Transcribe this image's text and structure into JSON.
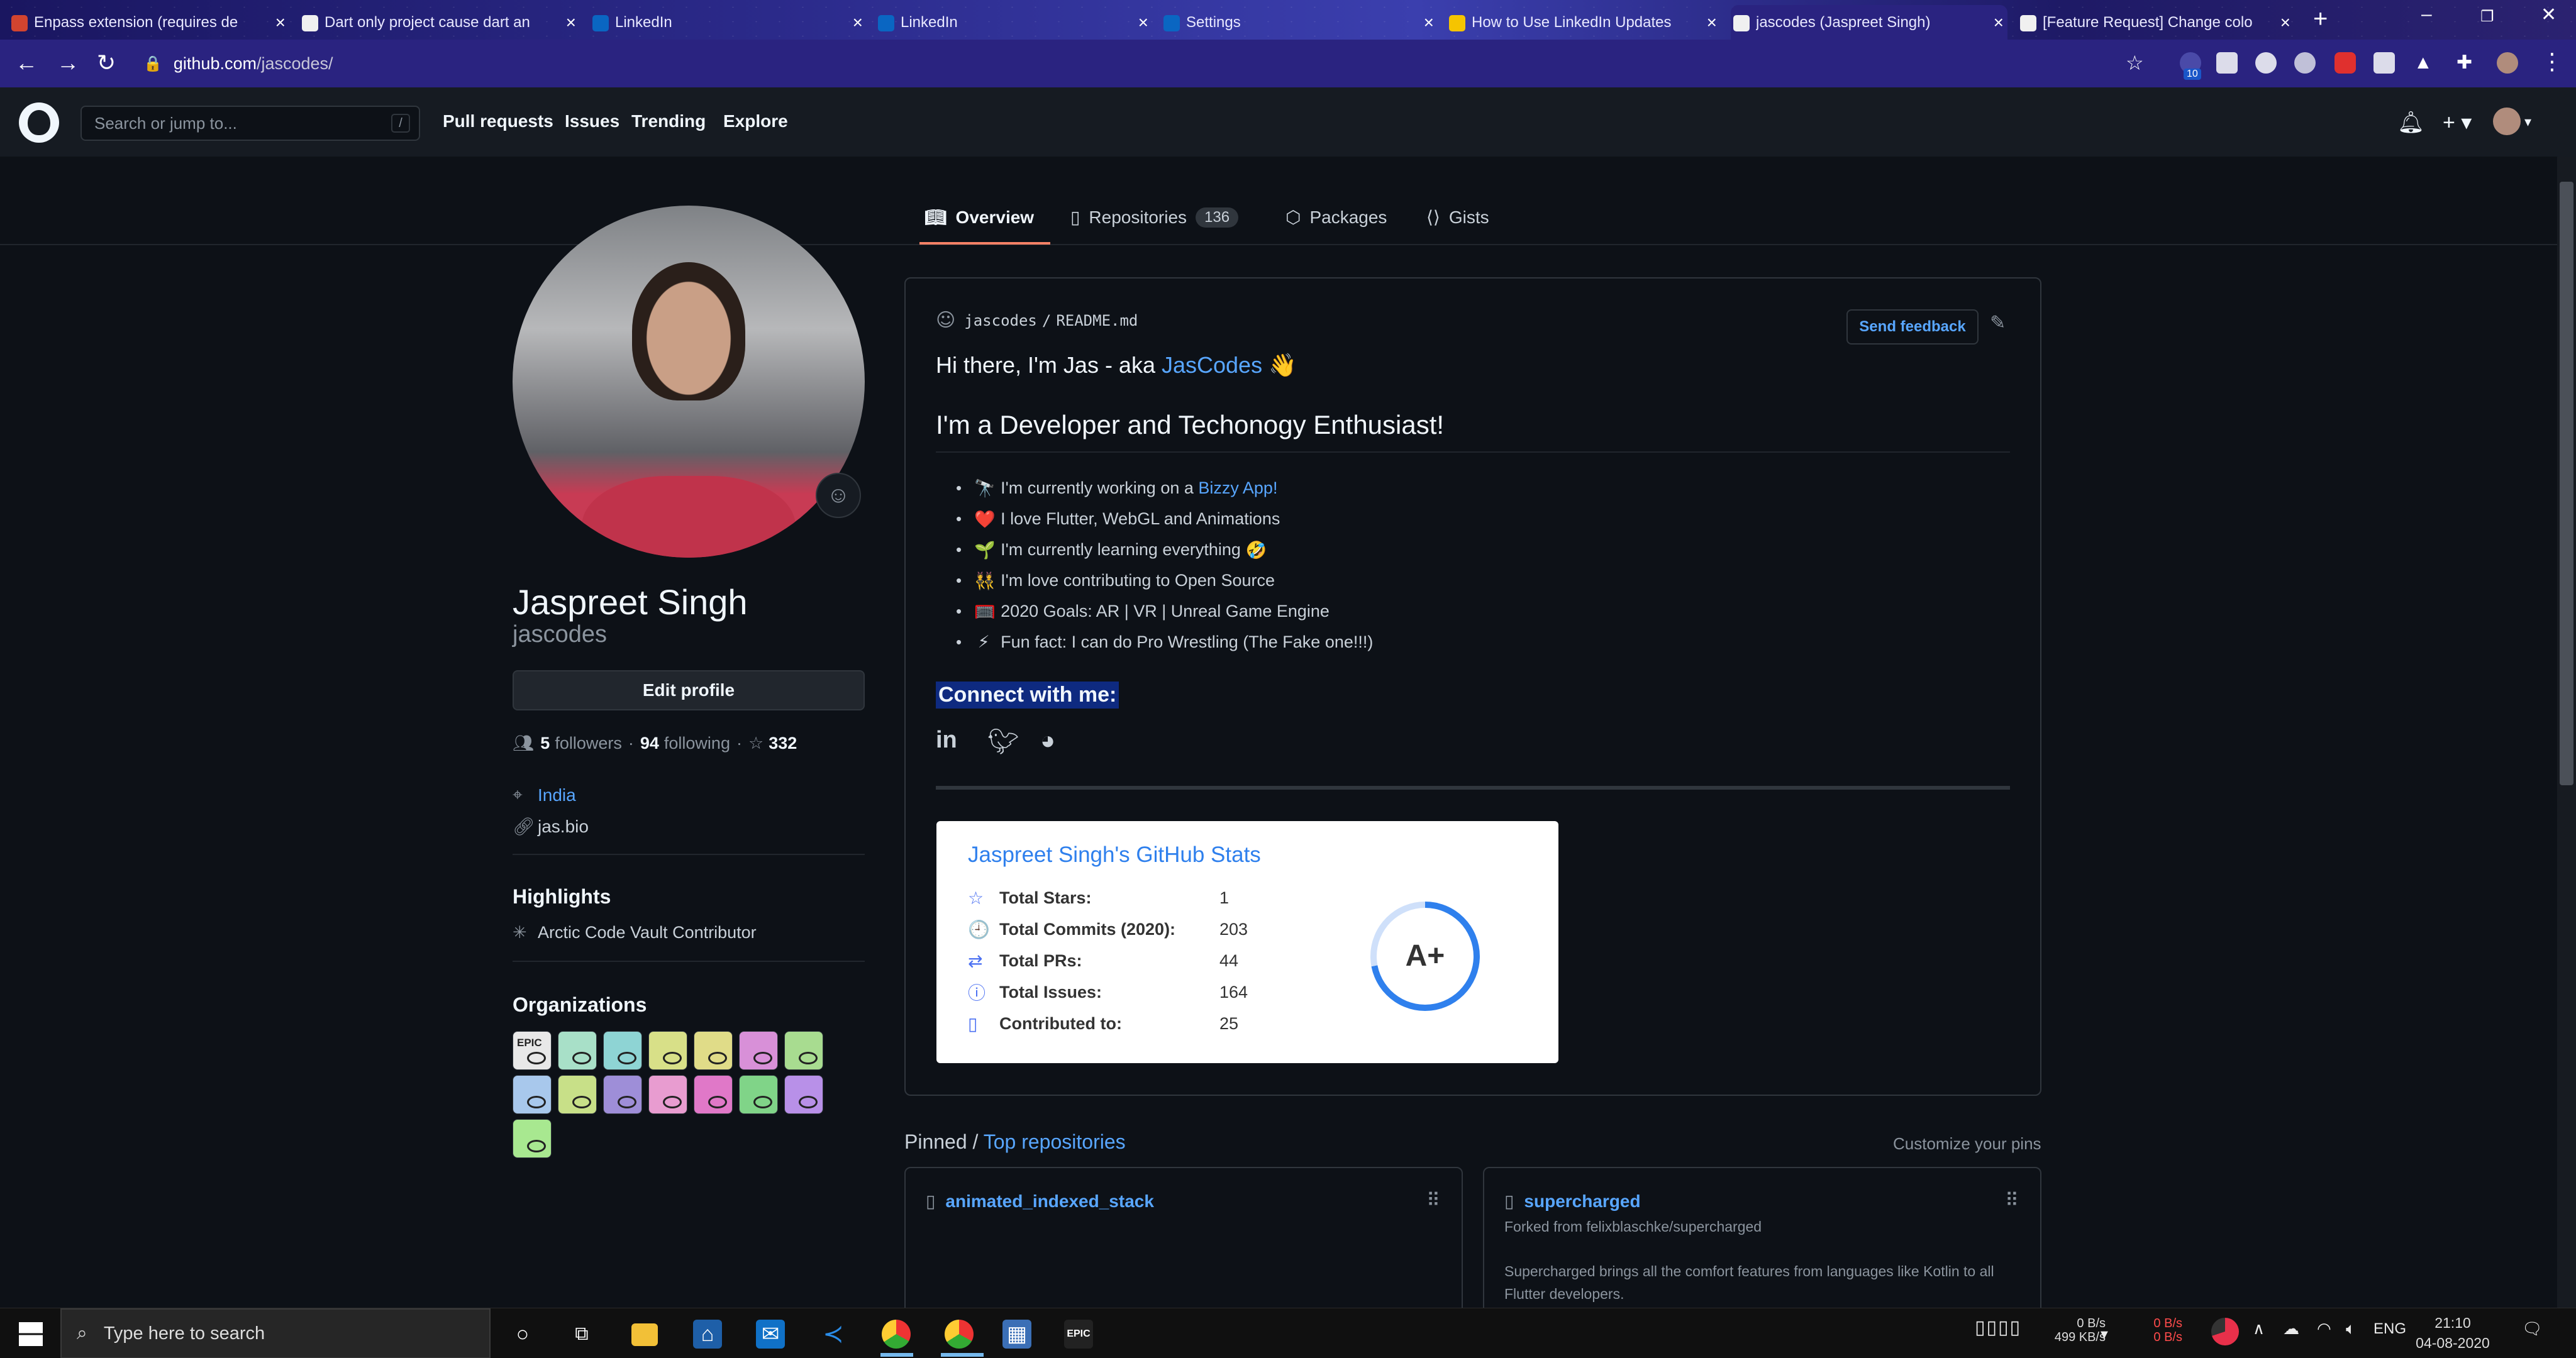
{
  "browser": {
    "tabs": [
      {
        "title": "Enpass extension (requires de",
        "favicon_color": "#d2442f"
      },
      {
        "title": "Dart only project cause dart an",
        "favicon_color": "#f0f0f0"
      },
      {
        "title": "LinkedIn",
        "favicon_color": "#0a66c2"
      },
      {
        "title": "LinkedIn",
        "favicon_color": "#0a66c2"
      },
      {
        "title": "Settings",
        "favicon_color": "#0a66c2"
      },
      {
        "title": "How to Use LinkedIn Updates",
        "favicon_color": "#f5c400"
      },
      {
        "title": "jascodes (Jaspreet Singh)",
        "favicon_color": "#f0f0f0"
      },
      {
        "title": "[Feature Request] Change colo",
        "favicon_color": "#f0f0f0"
      }
    ],
    "active_tab": 6,
    "url_host": "github.com",
    "url_path": "/jascodes/",
    "extension_badge": "10"
  },
  "github_header": {
    "search_placeholder": "Search or jump to...",
    "search_shortcut": "/",
    "nav": [
      "Pull requests",
      "Issues",
      "Trending",
      "Explore"
    ]
  },
  "profile_tabs": [
    {
      "label": "Overview",
      "icon": "book-icon",
      "glyph": "📖"
    },
    {
      "label": "Repositories",
      "icon": "repo-icon",
      "glyph": "▯",
      "count": "136"
    },
    {
      "label": "Packages",
      "icon": "package-icon",
      "glyph": "⬡"
    },
    {
      "label": "Gists",
      "icon": "code-square-icon",
      "glyph": "⟨⟩"
    }
  ],
  "profile": {
    "name": "Jaspreet Singh",
    "login": "jascodes",
    "edit_label": "Edit profile",
    "followers": "5",
    "followers_label": "followers",
    "following": "94",
    "following_label": "following",
    "stars": "332",
    "location": "India",
    "website": "jas.bio",
    "highlights_title": "Highlights",
    "highlight": "Arctic Code Vault Contributor",
    "orgs_title": "Organizations"
  },
  "organizations": [
    {
      "color": "#e8e8e8",
      "label": "EPIC"
    },
    {
      "color": "#a8e0c8"
    },
    {
      "color": "#8ed4d4"
    },
    {
      "color": "#d8e088"
    },
    {
      "color": "#e0dc88"
    },
    {
      "color": "#d890d8"
    },
    {
      "color": "#a8dc90"
    },
    {
      "color": "#a8c8ec"
    },
    {
      "color": "#c8e088"
    },
    {
      "color": "#9e8ed8"
    },
    {
      "color": "#e89cd0"
    },
    {
      "color": "#e078c8"
    },
    {
      "color": "#80d488"
    },
    {
      "color": "#b890e8"
    },
    {
      "color": "#a8e890"
    }
  ],
  "readme": {
    "owner": "jascodes",
    "file": "README.md",
    "send_feedback": "Send feedback",
    "greeting_pre": "Hi there, I'm Jas - aka ",
    "greeting_link": "JasCodes",
    "greeting_emoji": "👋",
    "heading": "I'm a Developer and Techonogy Enthusiast!",
    "items": [
      {
        "emoji": "🔭",
        "text": "I'm currently working on a ",
        "link": "Bizzy App",
        "after": "!"
      },
      {
        "emoji": "❤️",
        "text": "I love Flutter, WebGL and Animations"
      },
      {
        "emoji": "🌱",
        "text": "I'm currently learning everything ",
        "after_emoji": "🤣"
      },
      {
        "emoji": "👯",
        "text": "I'm love contributing to Open Source"
      },
      {
        "emoji": "🥅",
        "text": "2020 Goals: AR | VR | Unreal Game Engine"
      },
      {
        "emoji": "⚡",
        "text": "Fun fact: I can do Pro Wrestling (The Fake one!!!)"
      }
    ],
    "connect": "Connect with me:",
    "social_icons": [
      "linkedin-icon",
      "twitter-icon",
      "website-icon"
    ]
  },
  "stats_card": {
    "title": "Jaspreet Singh's GitHub Stats",
    "rows": [
      {
        "icon": "star-icon",
        "glyph": "☆",
        "label": "Total Stars:",
        "value": "1"
      },
      {
        "icon": "history-icon",
        "glyph": "🕘",
        "label": "Total Commits (2020):",
        "value": "203"
      },
      {
        "icon": "pull-request-icon",
        "glyph": "⇄",
        "label": "Total PRs:",
        "value": "44"
      },
      {
        "icon": "issue-icon",
        "glyph": "ⓘ",
        "label": "Total Issues:",
        "value": "164"
      },
      {
        "icon": "repo-icon",
        "glyph": "▯",
        "label": "Contributed to:",
        "value": "25"
      }
    ],
    "grade": "A+",
    "accent": "#2f80ed"
  },
  "pinned": {
    "title_pre": "Pinned / ",
    "title_link": "Top repositories",
    "customize": "Customize your pins",
    "repos": [
      {
        "name": "animated_indexed_stack",
        "subtitle": "",
        "description": ""
      },
      {
        "name": "supercharged",
        "subtitle": "Forked from felixblaschke/supercharged",
        "description": "Supercharged brings all the comfort features from languages like Kotlin to all Flutter developers."
      }
    ]
  },
  "taskbar": {
    "search_placeholder": "Type here to search",
    "net_up": "0 B/s",
    "net_down": "499 KB/s",
    "disk_read": "0 B/s",
    "disk_write": "0 B/s",
    "language": "ENG",
    "time": "21:10",
    "date": "04-08-2020"
  },
  "colors": {
    "link": "#58a6ff",
    "bg": "#0d1117",
    "header": "#161b22",
    "tab_accent": "#f78166"
  }
}
